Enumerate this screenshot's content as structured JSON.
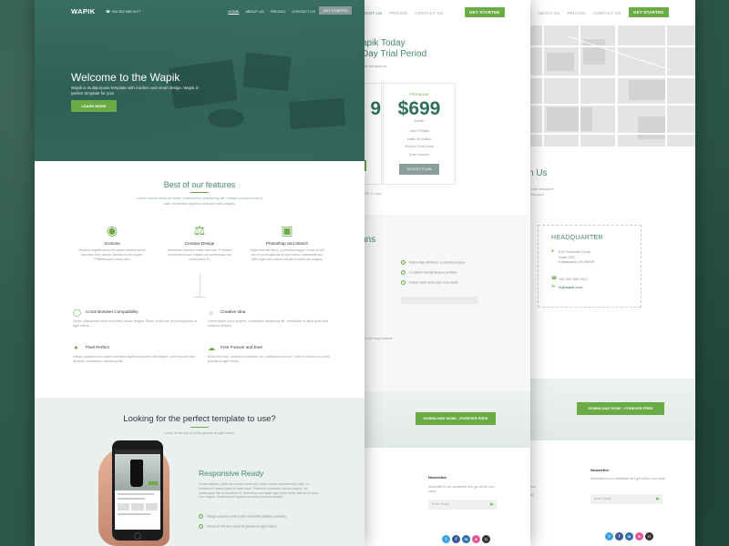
{
  "brand": {
    "logo": "WAPIK",
    "accent": "#6aab45",
    "dark_green": "#2f6e5a"
  },
  "front": {
    "nav": {
      "phone": "+62 202 555 0177",
      "links": [
        "HOME",
        "ABOUT US",
        "PRICING",
        "CONTACT US"
      ],
      "cta": "GET STARTED"
    },
    "hero": {
      "title": "Welcome to the Wapik",
      "subtitle": "Wapik is multipurpose template with modern and smart design. Wapik is perfect template for you!",
      "button": "LEARN MORE"
    },
    "features": {
      "title": "Best of our features",
      "subtitle": "Lorem ipsum dolor sit amet, consectetur adipiscing elit. Integer posuere erat a ante venenatis dapibus posuere velit aliquet.",
      "columns": [
        {
          "name": "Iconions",
          "icon": "target-icon",
          "desc": "Vivamus sagittis lacus vel augue laoreet rutrum faucibus dolor auctor. Aenean eu leo quam. Pellentesque ornare sem"
        },
        {
          "name": "Creative Design",
          "icon": "flask-icon",
          "desc": "Maecenas faucibus mollis interdum. Praesent commodo cursus magna, vel scelerisque nisl consectetur et."
        },
        {
          "name": "Photoshop and Sketch",
          "icon": "browser-window-icon",
          "desc": "Nulla vitae elit libero, a pharetra augue. Donec id elit non mi porta gravida at eget metus. Maecenas sed diam eget risus varius blandit sit amet non magna."
        }
      ],
      "rows": [
        {
          "name": "Cross Browser Compatibility",
          "icon": "globe-icon",
          "desc": "Donec ullamcorper nulla non metus auctor fringilla. Donec id elit non mi porta gravida at eget metus."
        },
        {
          "name": "Creative Idea",
          "icon": "lightbulb-icon",
          "desc": "Lorem ipsum dolor sit amet, consectetur adipiscing elit. Vestibulum id ligula porta felis euismod semper."
        },
        {
          "name": "Pixel Perfect",
          "icon": "magic-wand-icon",
          "desc": "Integer posuere erat a ante venenatis dapibus posuere velit aliquet. Lorem ipsum dolor sit amet, consectetur adipiscing elit."
        },
        {
          "name": "Free Forever and Ever",
          "icon": "cloud-download-icon",
          "desc": "Morbi leo risus, porta ac consectetur ac, vestibulum at eros. Donec id elit non mi porta gravida at eget metus."
        }
      ]
    },
    "looking": {
      "title": "Looking for the perfect template to use?",
      "subtitle": "Donec id elit non mi porta gravida at eget metus."
    },
    "responsive": {
      "title": "Responsive Ready",
      "text": "Fusce dapibus, tellus ac cursus commodo, tortor mauris condimentum nibh, ut fermentum massa justo sit amet risus. Praesent commodo cursus magna, vel scelerisque nisl consectetur et. Maecenas sed diam eget risus varius blandit sit amet non magna. Vestibulum id ligula porta felis euismod semper.",
      "items": [
        "Integer posuere erat a ante venenatis dapibus posuere",
        "Donec id elit non mi porta gravida at eget metus."
      ]
    }
  },
  "middle": {
    "nav": {
      "links": [
        "US",
        "ABOUT US",
        "PRICING",
        "CONTACT US"
      ],
      "cta": "GET STARTED"
    },
    "title_line1": "apik Today",
    "title_line2": "Day Trial Period",
    "subtitle": "met fermentum.",
    "left_price": "9",
    "plan": {
      "label": "PREMIUM",
      "price": "$699",
      "period": "/month",
      "features": [
        "Justo Fringilla",
        "Mollis Sit Nullam",
        "Ultricies Purus Amet",
        "Cras Inceptos"
      ],
      "button": "SELECT PLAN"
    },
    "free_note": "REE 14 days",
    "plans_title": "ll Plans",
    "plans_left_rows": [
      "ssed",
      "tur"
    ],
    "plans_items": [
      "Nulla vitae elit libero, a pharetra augue",
      "Curabitur blandit tempus porttitor",
      "Nullam quis risus eget urna mollis"
    ],
    "question_title": "?",
    "question_text": "dy to help you with any possible information.",
    "question_link": "oh",
    "download": "DOWNLOAD NOW! - FOREVER FREE",
    "footer_left": [
      "rk",
      "elit",
      "ribus",
      "ciat"
    ],
    "newsletter": {
      "title": "Newsletter",
      "text": "Subscribe to our newsletter and get all the cool news",
      "placeholder": "Enter Email"
    }
  },
  "right": {
    "nav": {
      "links": [
        "ABOUT US",
        "PRICING",
        "CONTACT US"
      ],
      "cta": "GET STARTED"
    },
    "contact_title": "h Us",
    "contact_text_1": "ut our services?",
    "contact_text_2": "from you!",
    "hq": {
      "title": "HEADQUARTER",
      "address": [
        "610 Overlook Circle",
        "Suite 323",
        "Kalamazoo, MI 49009"
      ],
      "phone": "+62 202 555 0117",
      "email": "hi@wapik.com"
    },
    "download": "DOWNLOAD NOW! - FOREVER FREE",
    "footer_left": [
      "rk",
      "ribus",
      "ciat"
    ],
    "newsletter": {
      "title": "Newsletter",
      "text": "Subscribe to our newsletter and get all the cool news",
      "placeholder": "Enter Email"
    }
  },
  "social": [
    {
      "name": "twitter-icon",
      "glyph": "t",
      "color": "#3aa3e3"
    },
    {
      "name": "facebook-icon",
      "glyph": "f",
      "color": "#3b5998"
    },
    {
      "name": "linkedin-icon",
      "glyph": "in",
      "color": "#2a6fa8"
    },
    {
      "name": "dribbble-icon",
      "glyph": "●",
      "color": "#e3589a"
    },
    {
      "name": "instagram-icon",
      "glyph": "◘",
      "color": "#333"
    }
  ]
}
